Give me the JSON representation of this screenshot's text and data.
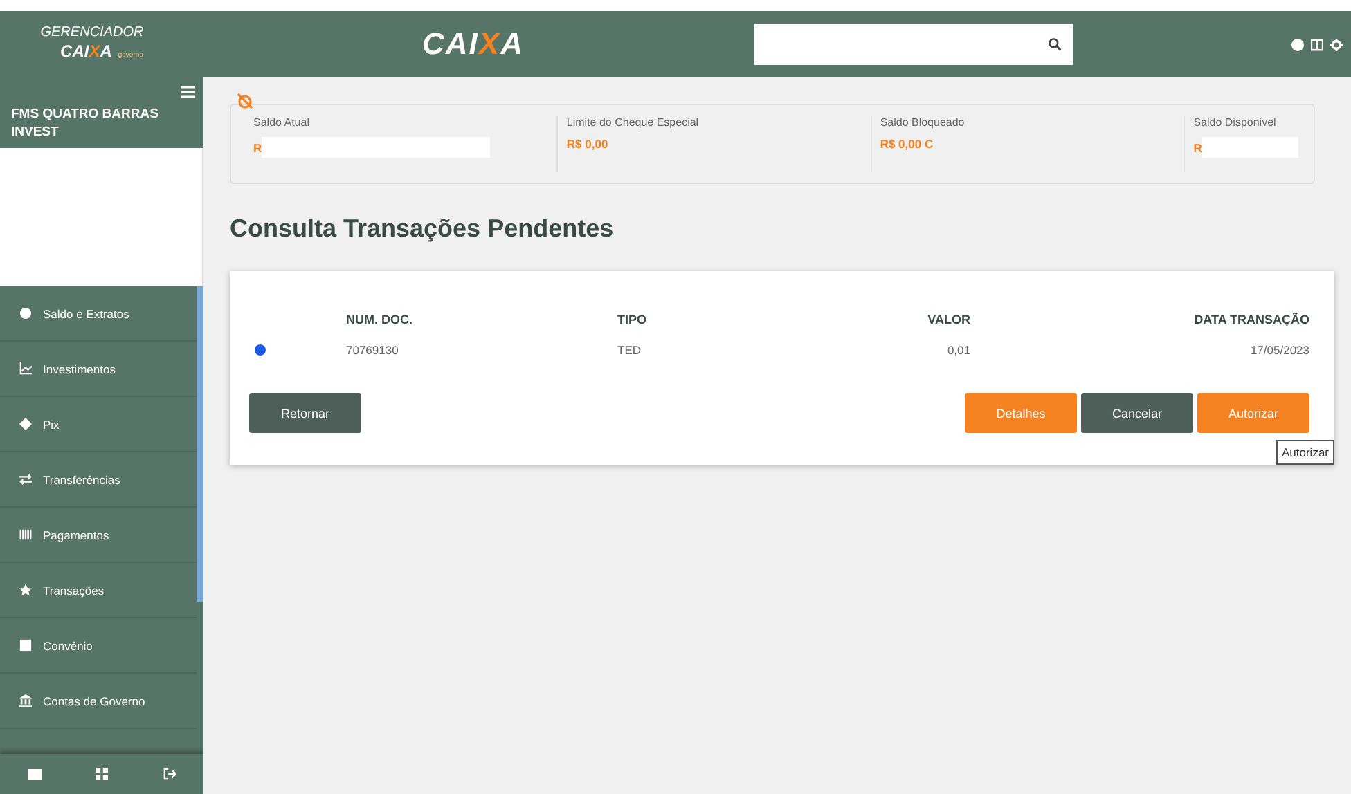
{
  "header": {
    "logo_top": "GERENCIADOR",
    "logo_bottom": "CAIXA",
    "logo_tag": "governo",
    "brand": "CAIXA"
  },
  "sidebar": {
    "account": "FMS QUATRO BARRAS INVEST",
    "items": [
      {
        "label": "Saldo e Extratos"
      },
      {
        "label": "Investimentos"
      },
      {
        "label": "Pix"
      },
      {
        "label": "Transferências"
      },
      {
        "label": "Pagamentos"
      },
      {
        "label": "Transações"
      },
      {
        "label": "Convênio"
      },
      {
        "label": "Contas de Governo"
      }
    ]
  },
  "balances": [
    {
      "label": "Saldo Atual",
      "value": "R",
      "masked": true
    },
    {
      "label": "Limite do Cheque Especial",
      "value": "R$ 0,00",
      "masked": false
    },
    {
      "label": "Saldo Bloqueado",
      "value": "R$ 0,00 C",
      "masked": false
    },
    {
      "label": "Saldo Disponivel",
      "value": "R",
      "masked": true
    }
  ],
  "page_title": "Consulta Transações Pendentes",
  "table": {
    "columns": [
      "NUM. DOC.",
      "TIPO",
      "VALOR",
      "DATA TRANSAÇÃO"
    ],
    "rows": [
      {
        "selected": true,
        "cells": [
          "70769130",
          "TED",
          "0,01",
          "17/05/2023"
        ]
      }
    ]
  },
  "buttons": [
    {
      "label": "Retornar",
      "kind": "dark"
    },
    {
      "label": "Detalhes",
      "kind": "orange"
    },
    {
      "label": "Cancelar",
      "kind": "dark"
    },
    {
      "label": "Autorizar",
      "kind": "orange"
    }
  ],
  "tooltip": "Autorizar"
}
